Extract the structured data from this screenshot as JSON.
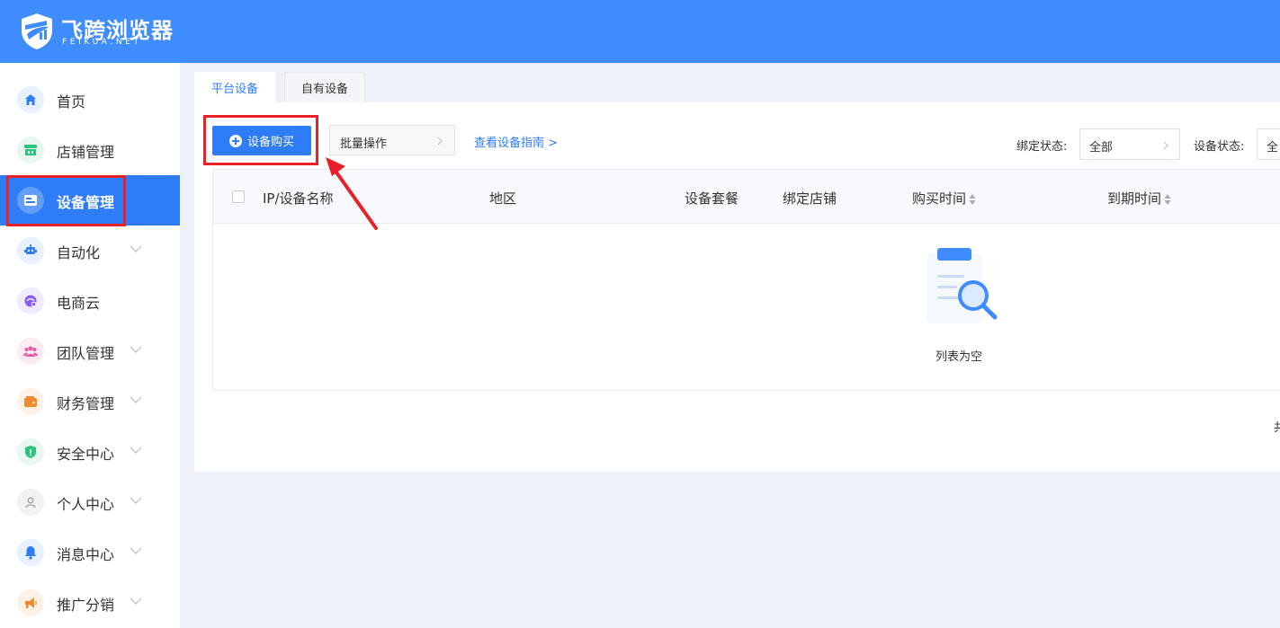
{
  "header": {
    "brand_cn": "飞跨浏览器",
    "brand_en": "FEIKUA.NET",
    "bg_color": "#3f8cff"
  },
  "sidebar": {
    "items": [
      {
        "label": "首页",
        "icon": "home-icon",
        "color": "#2e7cf6",
        "expandable": false
      },
      {
        "label": "店铺管理",
        "icon": "store-icon",
        "color": "#2ec27e",
        "expandable": false
      },
      {
        "label": "设备管理",
        "icon": "device-icon",
        "color": "#ffffff",
        "expandable": false,
        "active": true
      },
      {
        "label": "自动化",
        "icon": "robot-icon",
        "color": "#2e7cf6",
        "expandable": true
      },
      {
        "label": "电商云",
        "icon": "cloud-icon",
        "color": "#8a5cf6",
        "expandable": false
      },
      {
        "label": "团队管理",
        "icon": "team-icon",
        "color": "#e85aa8",
        "expandable": true
      },
      {
        "label": "财务管理",
        "icon": "wallet-icon",
        "color": "#f08a2e",
        "expandable": true
      },
      {
        "label": "安全中心",
        "icon": "shield-icon",
        "color": "#2ec27e",
        "expandable": true
      },
      {
        "label": "个人中心",
        "icon": "user-icon",
        "color": "#9aa0a8",
        "expandable": true
      },
      {
        "label": "消息中心",
        "icon": "bell-icon",
        "color": "#2e7cf6",
        "expandable": true
      },
      {
        "label": "推广分销",
        "icon": "megaphone-icon",
        "color": "#f08a2e",
        "expandable": true
      }
    ]
  },
  "tabs": [
    {
      "label": "平台设备",
      "active": true
    },
    {
      "label": "自有设备",
      "active": false
    }
  ],
  "toolbar": {
    "buy_label": "设备购买",
    "batch_label": "批量操作",
    "guide_label": "查看设备指南 >"
  },
  "filters": {
    "bind_label": "绑定状态:",
    "bind_value": "全部",
    "device_label": "设备状态:",
    "device_value": "全"
  },
  "table": {
    "columns": [
      "IP/设备名称",
      "地区",
      "设备套餐",
      "绑定店铺",
      "购买时间",
      "到期时间"
    ],
    "empty_text": "列表为空"
  },
  "footer": {
    "total_partial": "共"
  },
  "colors": {
    "accent": "#2e7cf6",
    "highlight": "#e8202a"
  }
}
